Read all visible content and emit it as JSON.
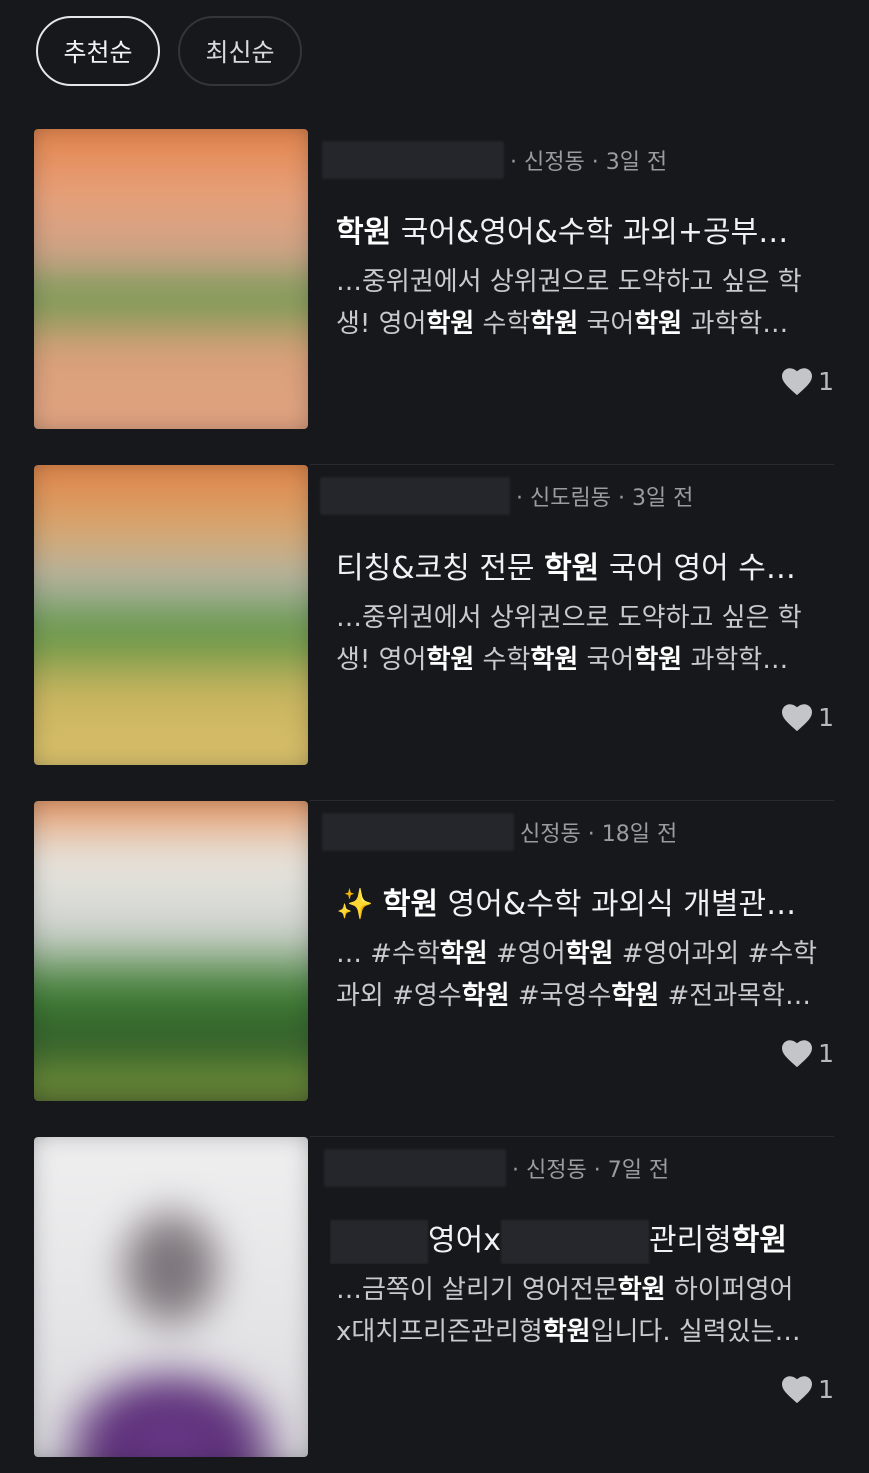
{
  "sort": {
    "recommended": "추천순",
    "latest": "최신순"
  },
  "posts": [
    {
      "location": "· 신정동",
      "time": "· 3일 전",
      "title_parts": [
        {
          "t": "학원",
          "b": true
        },
        {
          "t": " 국어&영어&수학 과외+공부…",
          "b": false
        }
      ],
      "snippet_lines": [
        [
          {
            "t": "…중위권에서 상위권으로 도약하고 싶은 학",
            "b": false
          }
        ],
        [
          {
            "t": "생! 영어",
            "b": false
          },
          {
            "t": "학원",
            "b": true
          },
          {
            "t": " 수학",
            "b": false
          },
          {
            "t": "학원",
            "b": true
          },
          {
            "t": " 국어",
            "b": false
          },
          {
            "t": "학원",
            "b": true
          },
          {
            "t": " 과학학…",
            "b": false
          }
        ]
      ],
      "likes": "1"
    },
    {
      "location": "· 신도림동",
      "time": "· 3일 전",
      "title_parts": [
        {
          "t": "티칭&코칭 전문 ",
          "b": false
        },
        {
          "t": "학원",
          "b": true
        },
        {
          "t": " 국어 영어 수…",
          "b": false
        }
      ],
      "snippet_lines": [
        [
          {
            "t": "…중위권에서 상위권으로 도약하고 싶은 학",
            "b": false
          }
        ],
        [
          {
            "t": "생! 영어",
            "b": false
          },
          {
            "t": "학원",
            "b": true
          },
          {
            "t": " 수학",
            "b": false
          },
          {
            "t": "학원",
            "b": true
          },
          {
            "t": " 국어",
            "b": false
          },
          {
            "t": "학원",
            "b": true
          },
          {
            "t": " 과학학…",
            "b": false
          }
        ]
      ],
      "likes": "1"
    },
    {
      "location": "신정동",
      "time": "· 18일 전",
      "title_parts": [
        {
          "t": "✨ ",
          "b": false
        },
        {
          "t": "학원",
          "b": true
        },
        {
          "t": " 영어&수학 과외식 개별관…",
          "b": false
        }
      ],
      "snippet_lines": [
        [
          {
            "t": "… #수학",
            "b": false
          },
          {
            "t": "학원",
            "b": true
          },
          {
            "t": " #영어",
            "b": false
          },
          {
            "t": "학원",
            "b": true
          },
          {
            "t": " #영어과외 #수학",
            "b": false
          }
        ],
        [
          {
            "t": "과외 #영수",
            "b": false
          },
          {
            "t": "학원",
            "b": true
          },
          {
            "t": " #국영수",
            "b": false
          },
          {
            "t": "학원",
            "b": true
          },
          {
            "t": " #전과목학…",
            "b": false
          }
        ]
      ],
      "likes": "1"
    },
    {
      "location": "· 신정동",
      "time": "· 7일 전",
      "title_parts": [
        {
          "t": "[R1]",
          "b": false
        },
        {
          "t": "영어x",
          "b": false
        },
        {
          "t": "[R2]",
          "b": false
        },
        {
          "t": "관리형",
          "b": false
        },
        {
          "t": "학원",
          "b": true
        }
      ],
      "snippet_lines": [
        [
          {
            "t": "…금쪽이 살리기 영어전문",
            "b": false
          },
          {
            "t": "학원",
            "b": true
          },
          {
            "t": " 하이퍼영어",
            "b": false
          }
        ],
        [
          {
            "t": "x대치프리즌관리형",
            "b": false
          },
          {
            "t": "학원",
            "b": true
          },
          {
            "t": "입니다. 실력있는…",
            "b": false
          }
        ]
      ],
      "likes": "1"
    }
  ],
  "colors": {
    "background": "#17181c",
    "text_primary": "#f1f1f3",
    "text_secondary": "#9a9ca2"
  },
  "icons": {
    "like": "heart-icon"
  }
}
